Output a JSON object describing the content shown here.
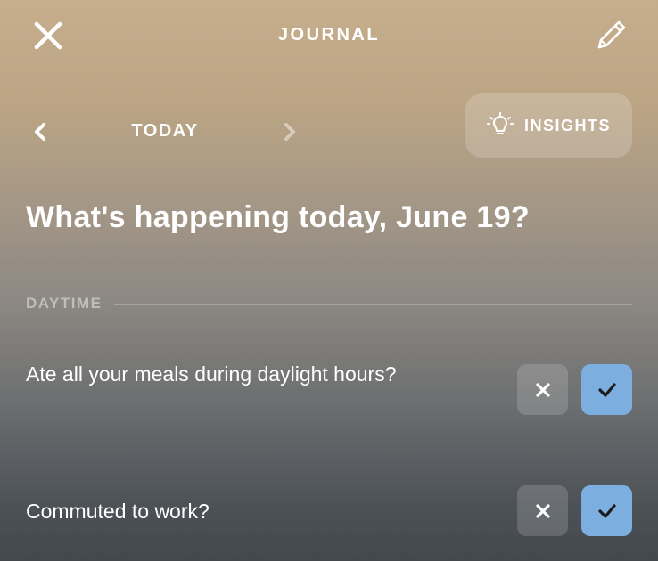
{
  "header": {
    "title": "JOURNAL",
    "close_icon": "close-icon",
    "edit_icon": "pencil-icon"
  },
  "date_nav": {
    "label": "TODAY",
    "prev_icon": "chevron-left-icon",
    "next_icon": "chevron-right-icon"
  },
  "insights": {
    "label": "INSIGHTS",
    "icon": "lightbulb-icon"
  },
  "page_title": "What's happening today, June 19?",
  "section": {
    "label": "DAYTIME"
  },
  "questions": [
    {
      "text": "Ate all your meals during daylight hours?",
      "answer": "yes"
    },
    {
      "text": "Commuted to work?",
      "answer": "yes"
    }
  ],
  "colors": {
    "accent": "#7caedf",
    "background_top": "#c6ae8d",
    "background_bottom": "#43484e"
  }
}
